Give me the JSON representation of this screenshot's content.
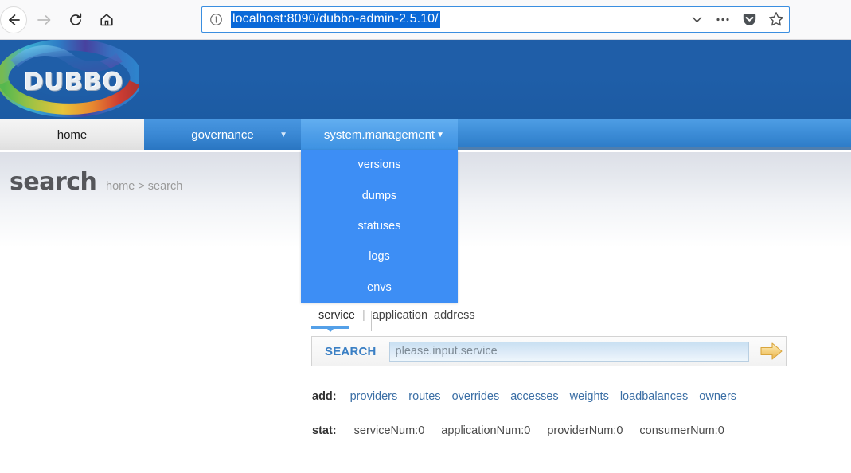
{
  "browser": {
    "back_icon": "back-arrow-icon",
    "forward_icon": "forward-arrow-icon",
    "reload_icon": "reload-icon",
    "home_icon": "home-icon",
    "identity_icon": "info-circle-icon",
    "url": "localhost:8090/dubbo-admin-2.5.10/",
    "url_selected": true,
    "actions": [
      {
        "name": "history-dropdown-icon",
        "glyph": "chevron-down"
      },
      {
        "name": "page-actions-icon",
        "glyph": "ellipsis"
      },
      {
        "name": "pocket-icon",
        "glyph": "pocket"
      },
      {
        "name": "bookmark-star-icon",
        "glyph": "star"
      }
    ]
  },
  "header": {
    "logo_text": "DUBBO"
  },
  "nav": {
    "tabs": [
      {
        "label": "home",
        "active": false,
        "has_caret": false
      },
      {
        "label": "governance",
        "active": false,
        "has_caret": true
      },
      {
        "label": "system.management",
        "active": true,
        "has_caret": true
      }
    ],
    "caret_glyph": "▼"
  },
  "dropdown": {
    "open_for": "system.management",
    "items": [
      {
        "label": "versions"
      },
      {
        "label": "dumps"
      },
      {
        "label": "statuses"
      },
      {
        "label": "logs"
      },
      {
        "label": "envs"
      }
    ]
  },
  "page": {
    "title": "search",
    "breadcrumb": "home > search"
  },
  "search_panel": {
    "tabs": [
      {
        "label": "service",
        "active": true
      },
      {
        "label": "application",
        "active": false
      },
      {
        "label": "address",
        "active": false
      }
    ],
    "separator": "|",
    "search_label": "SEARCH",
    "input_value": "",
    "input_placeholder": "please.input.service",
    "go_icon": "right-arrow-icon"
  },
  "add_row": {
    "label": "add:",
    "links": [
      "providers",
      "routes",
      "overrides",
      "accesses",
      "weights",
      "loadbalances",
      "owners"
    ]
  },
  "stat_row": {
    "label": "stat:",
    "items": [
      "serviceNum:0",
      "applicationNum:0",
      "providerNum:0",
      "consumerNum:0"
    ]
  },
  "colors": {
    "header_blue": "#1f5ea8",
    "nav_blue": "#3e8ed8",
    "active_tab_blue": "#4e9ee8",
    "dropdown_blue": "#3d8ef5",
    "url_highlight": "#0a69d8",
    "search_label_blue": "#3a7fc4",
    "link_blue": "#3a6ea5",
    "go_arrow_gold": "#f0c069"
  }
}
